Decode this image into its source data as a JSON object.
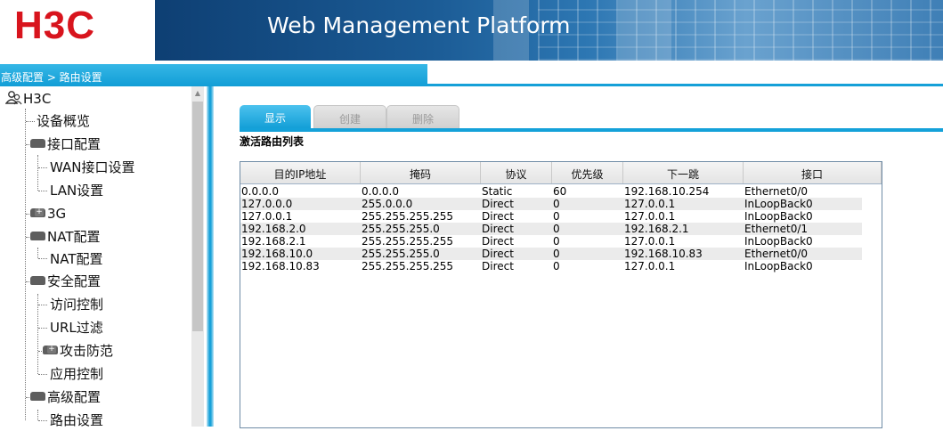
{
  "header": {
    "logo": "H3C",
    "title": "Web Management Platform",
    "colors": {
      "logo_red": "#d8141d",
      "banner_blue": "#1b5b95",
      "accent": "#16a0d8"
    }
  },
  "breadcrumb": "高级配置 > 路由设置",
  "sidebar": {
    "root": "H3C",
    "items": [
      {
        "label": "设备概览"
      },
      {
        "label": "接口配置"
      },
      {
        "label": "WAN接口设置"
      },
      {
        "label": "LAN设置"
      },
      {
        "label": "3G"
      },
      {
        "label": "NAT配置"
      },
      {
        "label": "NAT配置"
      },
      {
        "label": "安全配置"
      },
      {
        "label": "访问控制"
      },
      {
        "label": "URL过滤"
      },
      {
        "label": "攻击防范"
      },
      {
        "label": "应用控制"
      },
      {
        "label": "高级配置"
      },
      {
        "label": "路由设置"
      }
    ]
  },
  "tabs": [
    {
      "label": "显示"
    },
    {
      "label": "创建"
    },
    {
      "label": "删除"
    }
  ],
  "section_title": "激活路由列表",
  "table": {
    "columns": [
      "目的IP地址",
      "掩码",
      "协议",
      "优先级",
      "下一跳",
      "接口"
    ],
    "rows": [
      [
        "0.0.0.0",
        "0.0.0.0",
        "Static",
        "60",
        "192.168.10.254",
        "Ethernet0/0"
      ],
      [
        "127.0.0.0",
        "255.0.0.0",
        "Direct",
        "0",
        "127.0.0.1",
        "InLoopBack0"
      ],
      [
        "127.0.0.1",
        "255.255.255.255",
        "Direct",
        "0",
        "127.0.0.1",
        "InLoopBack0"
      ],
      [
        "192.168.2.0",
        "255.255.255.0",
        "Direct",
        "0",
        "192.168.2.1",
        "Ethernet0/1"
      ],
      [
        "192.168.2.1",
        "255.255.255.255",
        "Direct",
        "0",
        "127.0.0.1",
        "InLoopBack0"
      ],
      [
        "192.168.10.0",
        "255.255.255.0",
        "Direct",
        "0",
        "192.168.10.83",
        "Ethernet0/0"
      ],
      [
        "192.168.10.83",
        "255.255.255.255",
        "Direct",
        "0",
        "127.0.0.1",
        "InLoopBack0"
      ]
    ]
  }
}
